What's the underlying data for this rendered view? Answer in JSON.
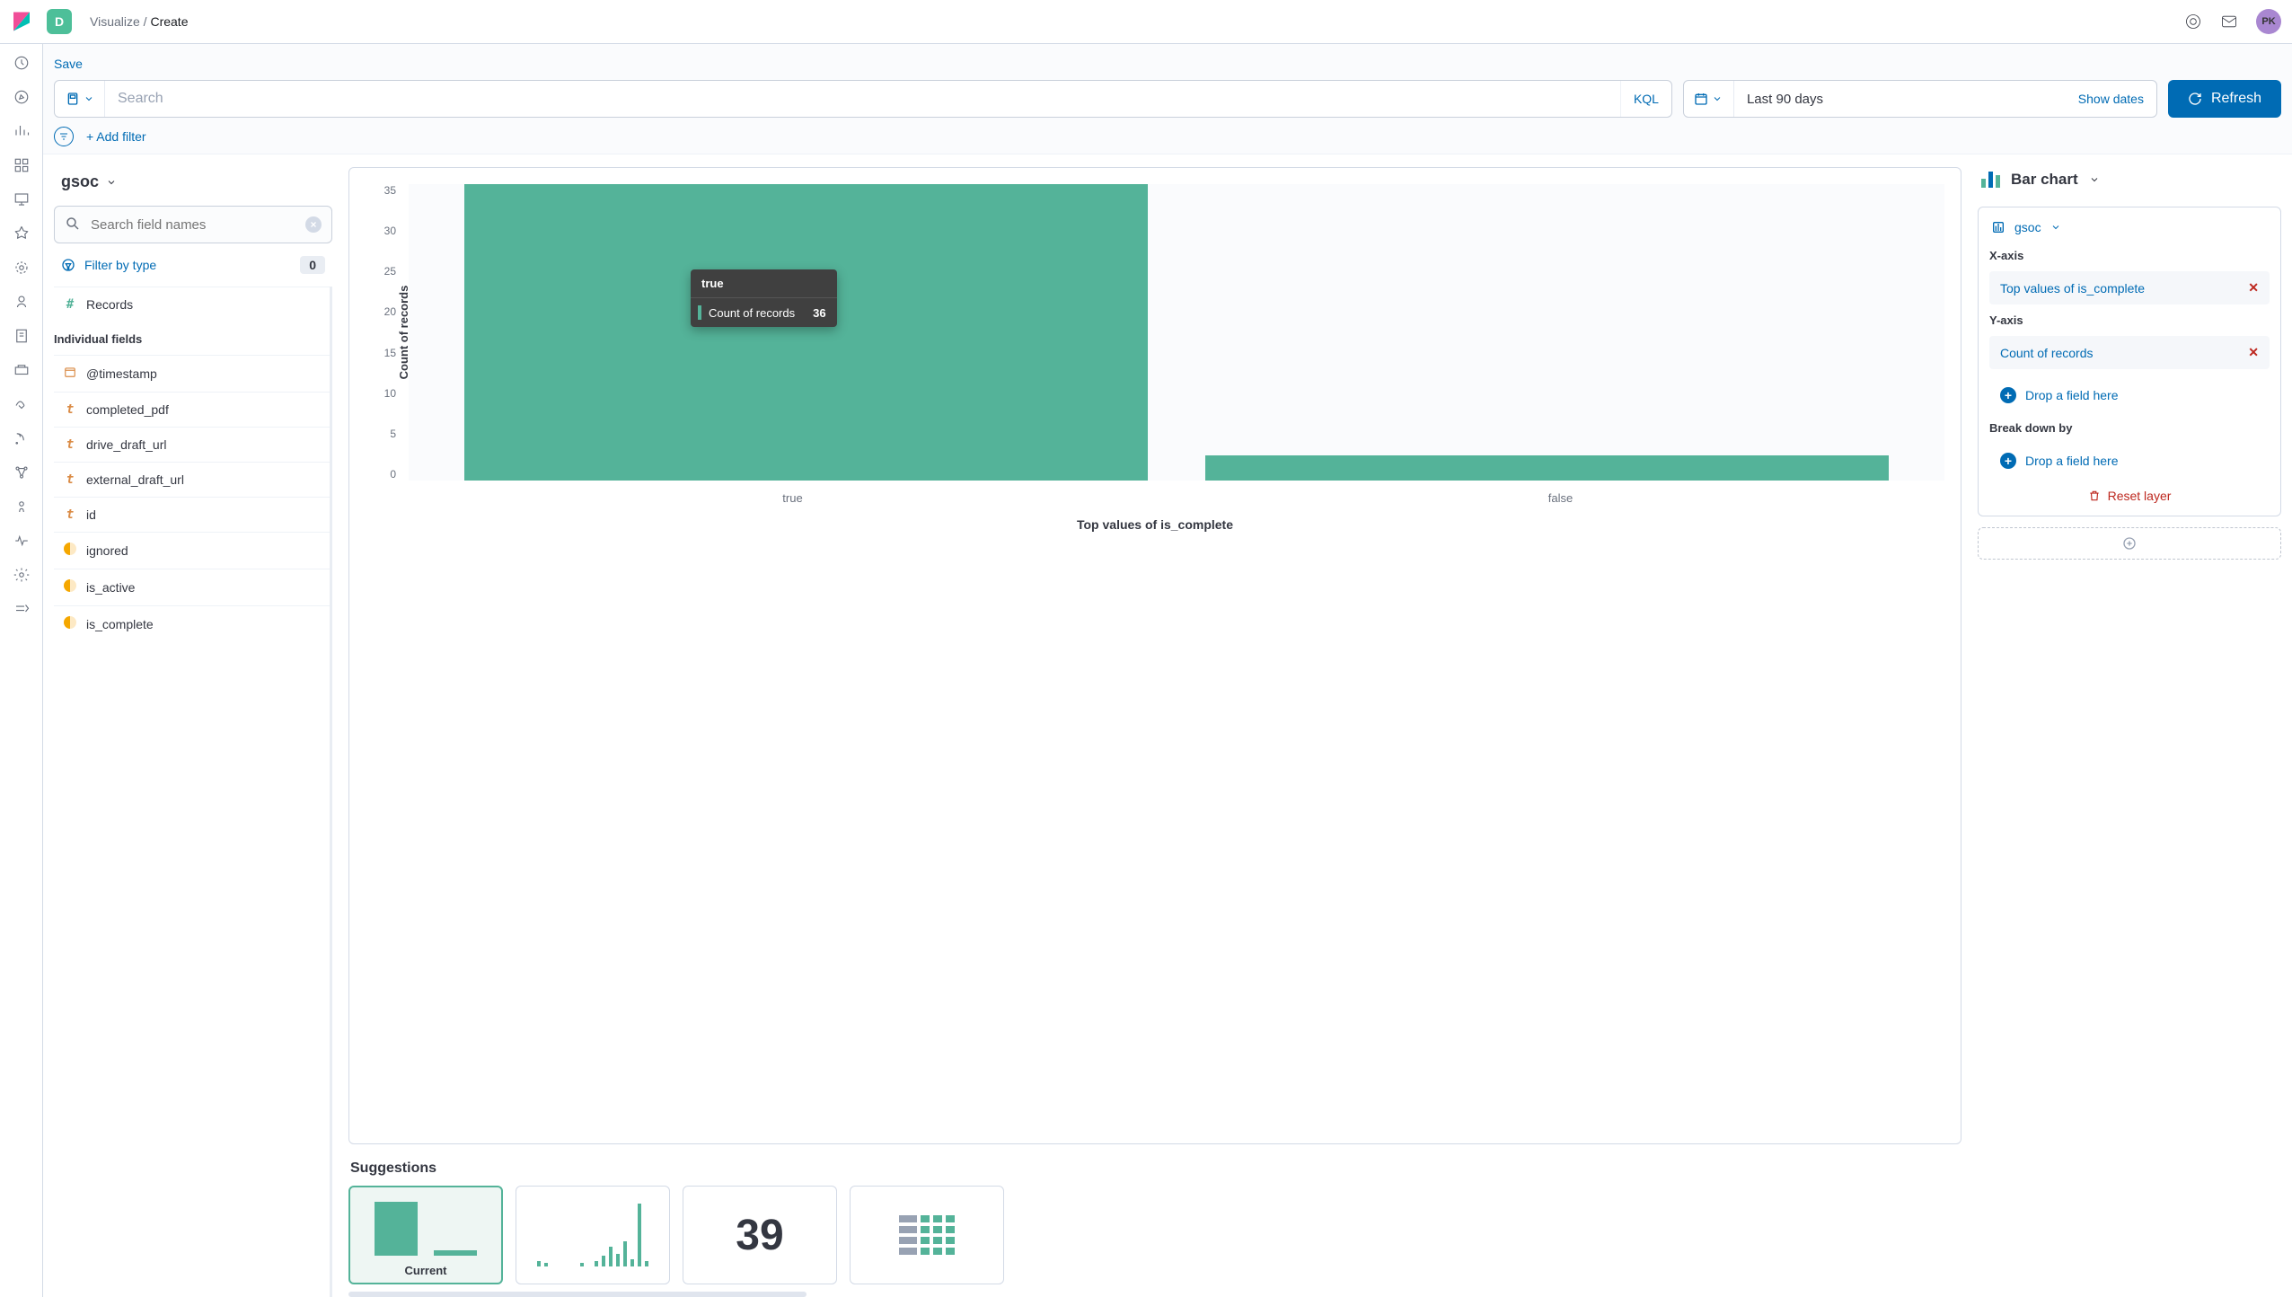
{
  "header": {
    "space": "D",
    "crumb_parent": "Visualize",
    "crumb_sep": " / ",
    "crumb_current": "Create",
    "avatar": "PK"
  },
  "toolbar": {
    "save": "Save",
    "search_ph": "Search",
    "kql": "KQL",
    "daterange": "Last 90 days",
    "showdates": "Show dates",
    "refresh": "Refresh",
    "addfilter": "+ Add filter"
  },
  "fields": {
    "index": "gsoc",
    "search_ph": "Search field names",
    "filter_type": "Filter by type",
    "filter_count": "0",
    "records": "Records",
    "section": "Individual fields",
    "items": [
      {
        "icon": "date",
        "label": "@timestamp"
      },
      {
        "icon": "str",
        "label": "completed_pdf"
      },
      {
        "icon": "str",
        "label": "drive_draft_url"
      },
      {
        "icon": "str",
        "label": "external_draft_url"
      },
      {
        "icon": "str",
        "label": "id"
      },
      {
        "icon": "bool",
        "label": "ignored"
      },
      {
        "icon": "bool",
        "label": "is_active"
      },
      {
        "icon": "bool",
        "label": "is_complete"
      }
    ]
  },
  "chart_data": {
    "type": "bar",
    "categories": [
      "true",
      "false"
    ],
    "values": [
      36,
      3
    ],
    "ylabel": "Count of records",
    "xlabel": "Top values of is_complete",
    "ylim": [
      0,
      35
    ],
    "yticks": [
      "35",
      "30",
      "25",
      "20",
      "15",
      "10",
      "5",
      "0"
    ],
    "tooltip": {
      "header": "true",
      "label": "Count of records",
      "value": "36"
    }
  },
  "suggestions": {
    "title": "Suggestions",
    "current": "Current",
    "metric": "39"
  },
  "config": {
    "chart_type": "Bar chart",
    "layer_index": "gsoc",
    "x_label": "X-axis",
    "x_value": "Top values of is_complete",
    "y_label": "Y-axis",
    "y_value": "Count of records",
    "drop": "Drop a field here",
    "break_label": "Break down by",
    "reset": "Reset layer"
  }
}
